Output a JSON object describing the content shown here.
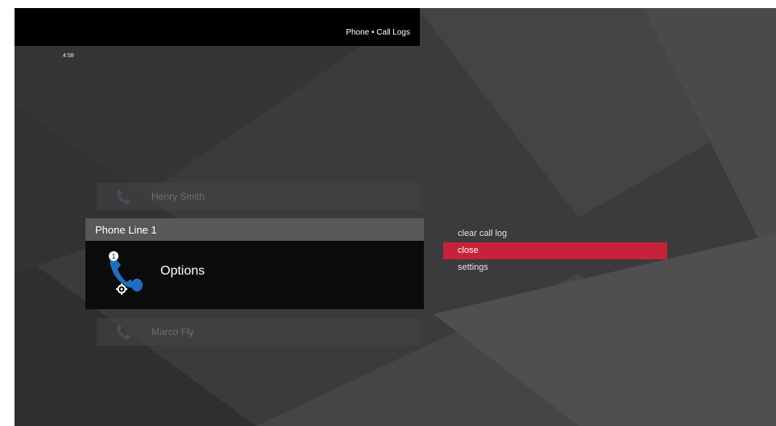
{
  "header": {
    "title": "Phone • Call Logs"
  },
  "status": {
    "time": "4:58"
  },
  "contacts": [
    {
      "name": "Henry Smith",
      "icon": "phone-handset-icon"
    },
    {
      "name": "Marco Fly",
      "icon": "phone-handset-icon"
    }
  ],
  "selected_item": {
    "line_label": "Phone Line 1",
    "title": "Options",
    "icon": "phone-settings-icon"
  },
  "menu": {
    "items": [
      {
        "label": "clear call log",
        "selected": false
      },
      {
        "label": "close",
        "selected": true
      },
      {
        "label": "settings",
        "selected": false
      }
    ]
  },
  "colors": {
    "accent": "#c8213a",
    "icon_blue": "#1f6fbf",
    "background": "#3a3a3c",
    "header": "#000000"
  }
}
